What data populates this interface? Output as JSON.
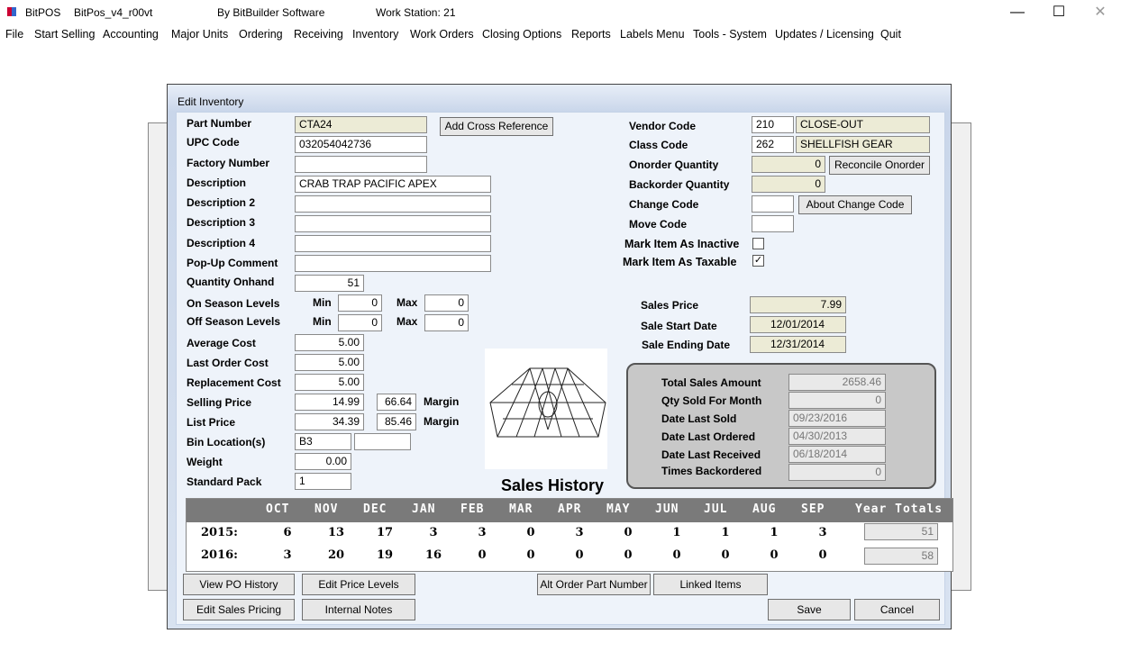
{
  "titlebar": {
    "app": "BitPOS",
    "version": "BitPos_v4_r00vt",
    "vendor": "By BitBuilder Software",
    "workstation": "Work Station: 21"
  },
  "menu": [
    "File",
    "Start Selling",
    "Accounting",
    "Major Units",
    "Ordering",
    "Receiving",
    "Inventory",
    "Work Orders",
    "Closing Options",
    "Reports",
    "Labels Menu",
    "Tools - System",
    "Updates / Licensing",
    "Quit"
  ],
  "dialog": {
    "title": "Edit Inventory"
  },
  "form": {
    "part_number_label": "Part Number",
    "part_number": "CTA24",
    "upc_label": "UPC Code",
    "upc": "032054042736",
    "factory_label": "Factory Number",
    "factory": "",
    "desc_label": "Description",
    "desc": "CRAB TRAP PACIFIC APEX",
    "desc2_label": "Description 2",
    "desc2": "",
    "desc3_label": "Description 3",
    "desc3": "",
    "desc4_label": "Description 4",
    "desc4": "",
    "popup_label": "Pop-Up Comment",
    "popup": "",
    "qty_label": "Quantity Onhand",
    "qty": "51",
    "on_season_label": "On Season Levels",
    "off_season_label": "Off Season Levels",
    "min_label": "Min",
    "max_label": "Max",
    "on_min": "0",
    "on_max": "0",
    "off_min": "0",
    "off_max": "0",
    "avg_cost_label": "Average Cost",
    "avg_cost": "5.00",
    "last_cost_label": "Last Order Cost",
    "last_cost": "5.00",
    "repl_cost_label": "Replacement Cost",
    "repl_cost": "5.00",
    "sell_label": "Selling Price",
    "sell": "14.99",
    "sell_margin": "66.64",
    "list_label": "List Price",
    "list": "34.39",
    "list_margin": "85.46",
    "margin_label": "Margin",
    "bin_label": "Bin Location(s)",
    "bin1": "B3",
    "bin2": "",
    "weight_label": "Weight",
    "weight": "0.00",
    "pack_label": "Standard Pack",
    "pack": "1",
    "vendor_label": "Vendor Code",
    "vendor_code": "210",
    "vendor_name": "CLOSE-OUT",
    "class_label": "Class Code",
    "class_code": "262",
    "class_name": "SHELLFISH GEAR",
    "onorder_label": "Onorder Quantity",
    "onorder": "0",
    "backorder_label": "Backorder Quantity",
    "backorder": "0",
    "change_label": "Change Code",
    "change": "",
    "move_label": "Move Code",
    "move": "",
    "inactive_label": "Mark Item As Inactive",
    "inactive": false,
    "taxable_label": "Mark Item As Taxable",
    "taxable": true,
    "sales_price_label": "Sales Price",
    "sales_price": "7.99",
    "sale_start_label": "Sale Start Date",
    "sale_start": "12/01/2014",
    "sale_end_label": "Sale Ending Date",
    "sale_end": "12/31/2014"
  },
  "buttons": {
    "add_cross": "Add Cross Reference",
    "reconcile": "Reconcile Onorder",
    "about_change": "About Change Code",
    "view_po": "View PO History",
    "edit_price": "Edit Price Levels",
    "edit_sales": "Edit Sales Pricing",
    "notes": "Internal Notes",
    "alt_order": "Alt Order Part Number",
    "linked": "Linked Items",
    "save": "Save",
    "cancel": "Cancel"
  },
  "stats": {
    "total_label": "Total Sales Amount",
    "total": "2658.46",
    "qty_month_label": "Qty Sold For Month",
    "qty_month": "0",
    "last_sold_label": "Date Last Sold",
    "last_sold": "09/23/2016",
    "last_ordered_label": "Date Last Ordered",
    "last_ordered": "04/30/2013",
    "last_received_label": "Date Last Received",
    "last_received": "06/18/2014",
    "times_bo_label": "Times Backordered",
    "times_bo": "0"
  },
  "history": {
    "title": "Sales History",
    "months": [
      "OCT",
      "NOV",
      "DEC",
      "JAN",
      "FEB",
      "MAR",
      "APR",
      "MAY",
      "JUN",
      "JUL",
      "AUG",
      "SEP"
    ],
    "totals_label": "Year Totals",
    "rows": [
      {
        "year": "2015:",
        "values": [
          "6",
          "13",
          "17",
          "3",
          "3",
          "0",
          "3",
          "0",
          "1",
          "1",
          "1",
          "3"
        ],
        "total": "51"
      },
      {
        "year": "2016:",
        "values": [
          "3",
          "20",
          "19",
          "16",
          "0",
          "0",
          "0",
          "0",
          "0",
          "0",
          "0",
          "0"
        ],
        "total": "58"
      }
    ]
  }
}
